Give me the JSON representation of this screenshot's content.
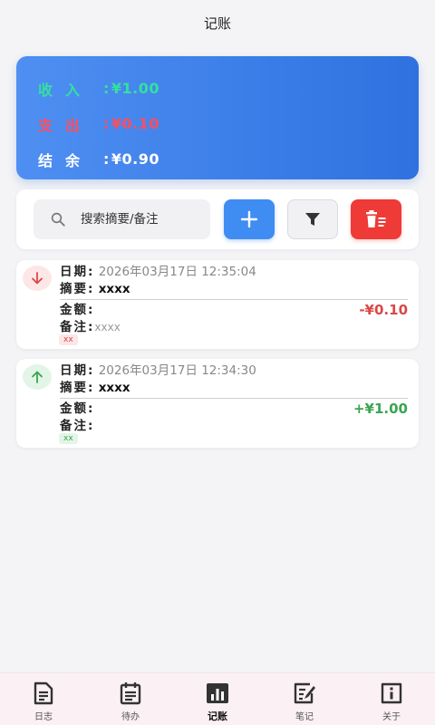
{
  "header": {
    "title": "记账"
  },
  "summary": {
    "income_label": "收入",
    "income_value": "¥1.00",
    "expense_label": "支出",
    "expense_value": "¥0.10",
    "balance_label": "结余",
    "balance_value": "¥0.90",
    "colors": {
      "income": "#33e0a0",
      "expense": "#ff4d5e",
      "balance": "#ffffff",
      "card": "#3d7fe9"
    }
  },
  "toolbar": {
    "search_placeholder": "搜索摘要/备注",
    "colors": {
      "add": "#3f8cf3",
      "delete": "#ee3b37"
    }
  },
  "records": [
    {
      "type": "expense",
      "date_label": "日期:",
      "date": "2026年03月17日 12:35:04",
      "summary_label": "摘要:",
      "summary": "xxxx",
      "amount_label": "金额:",
      "amount": "-¥0.10",
      "note_label": "备注:",
      "note": "xxxx",
      "tag": "xx"
    },
    {
      "type": "income",
      "date_label": "日期:",
      "date": "2026年03月17日 12:34:30",
      "summary_label": "摘要:",
      "summary": "xxxx",
      "amount_label": "金额:",
      "amount": "+¥1.00",
      "note_label": "备注:",
      "note": "",
      "tag": "xx"
    }
  ],
  "nav": [
    {
      "label": "日志",
      "icon": "log-icon"
    },
    {
      "label": "待办",
      "icon": "todo-icon"
    },
    {
      "label": "记账",
      "icon": "chart-icon",
      "active": true
    },
    {
      "label": "笔记",
      "icon": "note-edit-icon"
    },
    {
      "label": "关于",
      "icon": "info-icon"
    }
  ]
}
